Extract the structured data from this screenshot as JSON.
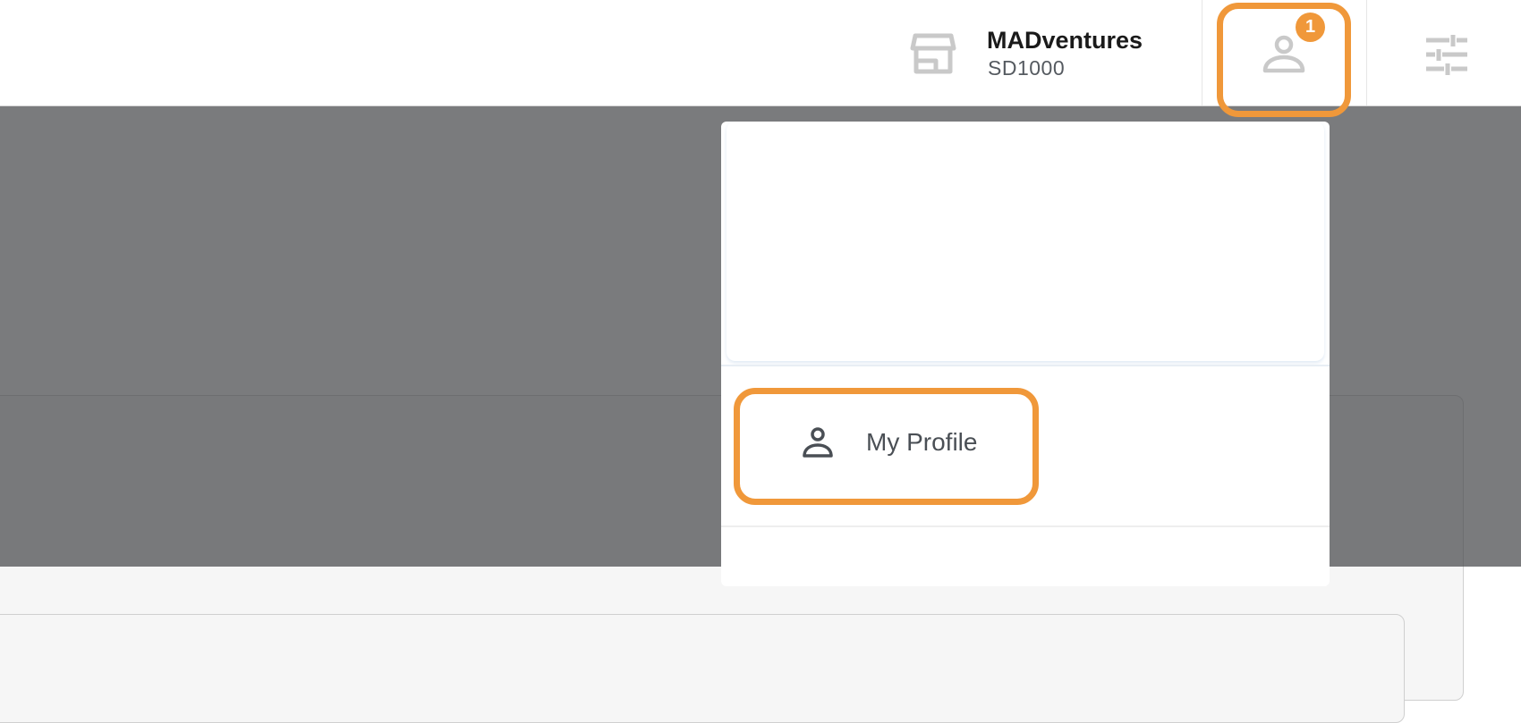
{
  "header": {
    "store": {
      "icon": "store-icon",
      "name": "MADventures",
      "code": "SD1000"
    },
    "account": {
      "icon": "account-icon",
      "notification_count": "1"
    },
    "settings": {
      "icon": "sliders-icon"
    }
  },
  "dropdown": {
    "items": [
      {
        "icon": "person-icon",
        "label": "My Profile"
      }
    ]
  },
  "colors": {
    "highlight": "#f0983a",
    "badge": "#f0983a",
    "overlay": "#46484b",
    "icon_muted": "#c9c9c9",
    "icon_dark": "#4a4f55"
  }
}
